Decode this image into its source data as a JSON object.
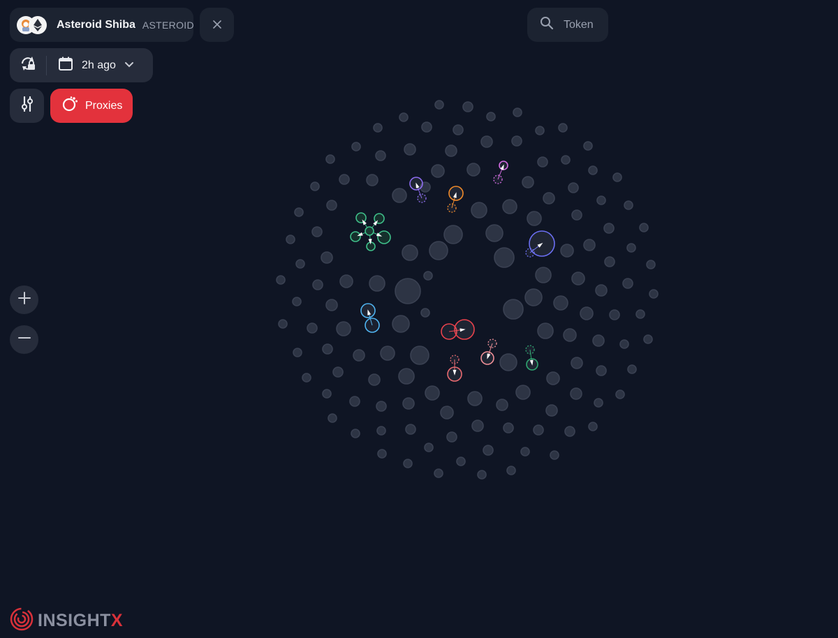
{
  "token": {
    "name": "Asteroid Shiba",
    "symbol": "ASTEROID",
    "avatar_icons": [
      "shiba-astronaut-icon",
      "ethereum-icon"
    ]
  },
  "search": {
    "label": "Token"
  },
  "time_filter": {
    "value": "2h ago"
  },
  "proxies": {
    "label": "Proxies"
  },
  "brand": {
    "name_main": "INSIGHT",
    "name_accent": "X"
  },
  "colors": {
    "background": "#0f1524",
    "panel": "#1c2331",
    "accent_red": "#e3323c",
    "bubble_gray": "#2d3444"
  },
  "clusters": [
    {
      "color": "#3fbf8a",
      "label": "green-star-cluster"
    },
    {
      "color": "#8d6cf0",
      "label": "purple-cluster"
    },
    {
      "color": "#f08a2a",
      "label": "orange-cluster"
    },
    {
      "color": "#d36be2",
      "label": "magenta-cluster"
    },
    {
      "color": "#6b6ff2",
      "label": "blue-large-cluster"
    },
    {
      "color": "#4fb3f0",
      "label": "sky-cluster"
    },
    {
      "color": "#e9424c",
      "label": "red-pair-cluster"
    },
    {
      "color": "#e96a70",
      "label": "red-single-cluster"
    },
    {
      "color": "#f08f97",
      "label": "pink-cluster"
    },
    {
      "color": "#2fa771",
      "label": "green-pair-cluster"
    }
  ]
}
